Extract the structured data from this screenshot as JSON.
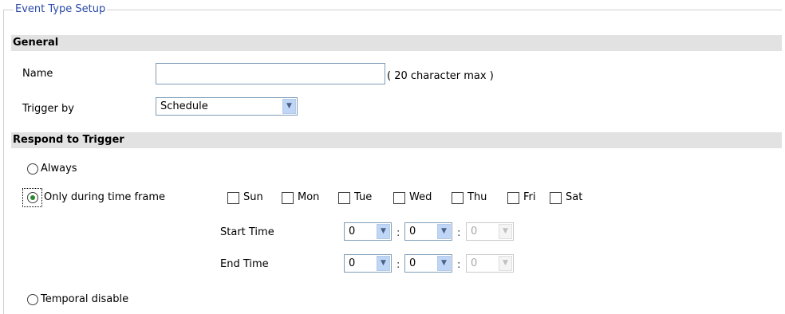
{
  "legend": "Event Type Setup",
  "general": {
    "heading": "General",
    "name_label": "Name",
    "name_value": "",
    "name_hint": "( 20 character max )",
    "trigger_label": "Trigger by",
    "trigger_value": "Schedule"
  },
  "respond": {
    "heading": "Respond to Trigger",
    "always_label": "Always",
    "always_checked": false,
    "timeframe_label": "Only during time frame",
    "timeframe_checked": true,
    "days": [
      {
        "label": "Sun",
        "checked": false
      },
      {
        "label": "Mon",
        "checked": false
      },
      {
        "label": "Tue",
        "checked": false
      },
      {
        "label": "Wed",
        "checked": false
      },
      {
        "label": "Thu",
        "checked": false
      },
      {
        "label": "Fri",
        "checked": false
      },
      {
        "label": "Sat",
        "checked": false
      }
    ],
    "start_label": "Start Time",
    "start_hour": "0",
    "start_min": "0",
    "start_sec": "0",
    "end_label": "End Time",
    "end_hour": "0",
    "end_min": "0",
    "end_sec": "0",
    "time_separator": ":",
    "temporal_label": "Temporal disable",
    "temporal_checked": false
  },
  "icons": {
    "dropdown": "chevron-down-icon",
    "radio": "radio-icon",
    "checkbox": "checkbox-icon"
  }
}
